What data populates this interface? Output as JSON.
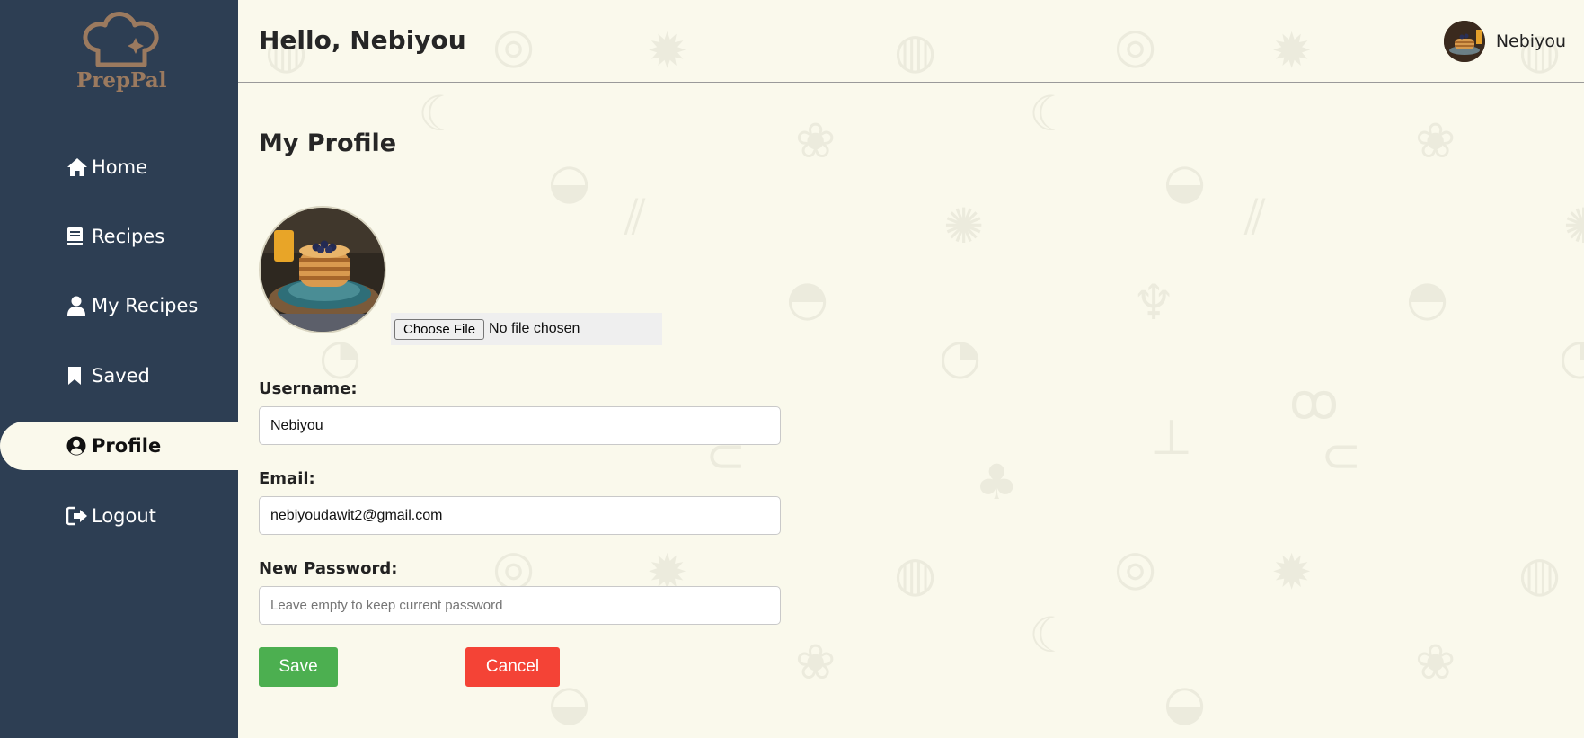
{
  "app": {
    "name": "PrepPal"
  },
  "sidebar": {
    "items": [
      {
        "label": "Home",
        "icon": "home-icon"
      },
      {
        "label": "Recipes",
        "icon": "book-icon"
      },
      {
        "label": "My Recipes",
        "icon": "user-icon"
      },
      {
        "label": "Saved",
        "icon": "bookmark-icon"
      },
      {
        "label": "Profile",
        "icon": "user-circle-icon",
        "active": true
      },
      {
        "label": "Logout",
        "icon": "logout-icon"
      }
    ]
  },
  "header": {
    "greeting": "Hello, Nebiyou",
    "user_name": "Nebiyou"
  },
  "main": {
    "title": "My Profile",
    "file": {
      "button_label": "Choose File",
      "status": "No file chosen"
    },
    "username": {
      "label": "Username:",
      "value": "Nebiyou"
    },
    "email": {
      "label": "Email:",
      "value": "nebiyoudawit2@gmail.com"
    },
    "password": {
      "label": "New Password:",
      "value": "",
      "placeholder": "Leave empty to keep current password"
    },
    "save_label": "Save",
    "cancel_label": "Cancel"
  },
  "colors": {
    "sidebar": "#2d3e53",
    "background": "#faf9ec",
    "logo": "#9b7a5f",
    "save": "#4caf50",
    "cancel": "#f44336"
  }
}
